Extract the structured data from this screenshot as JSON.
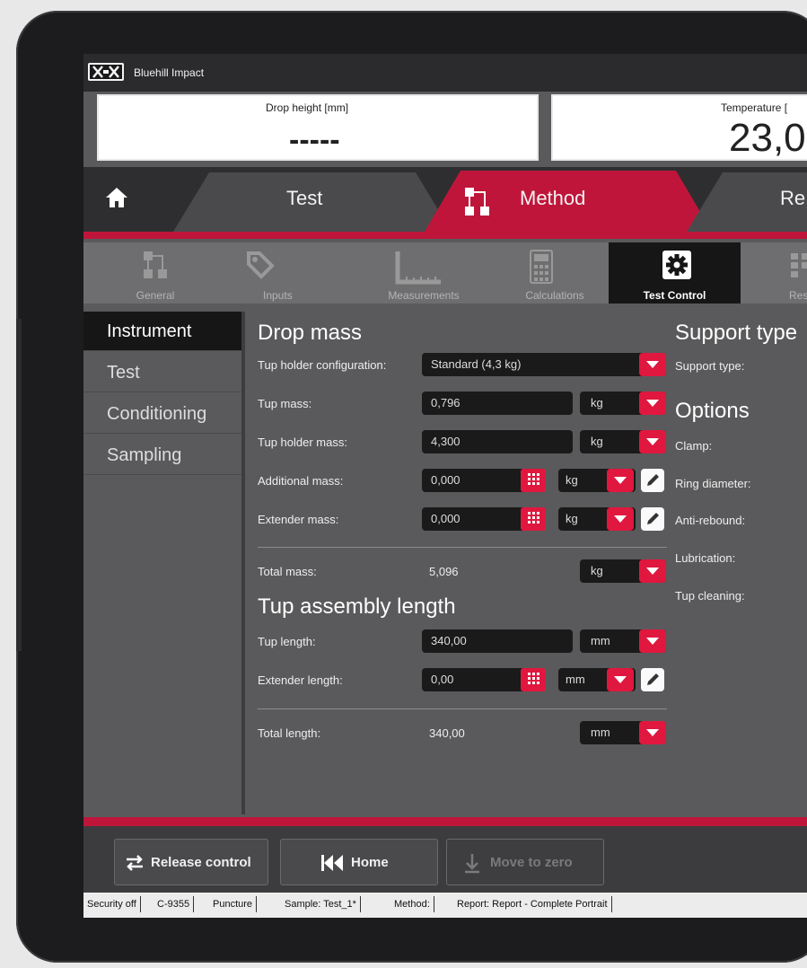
{
  "app": {
    "title": "Bluehill Impact"
  },
  "readouts": [
    {
      "label": "Drop height   [mm]",
      "value": "-----"
    },
    {
      "label": "Temperature   [",
      "value": "23,0"
    }
  ],
  "main_tabs": {
    "home_icon": "home-icon",
    "test": "Test",
    "method": "Method",
    "reports": "Re"
  },
  "sub_tabs": [
    {
      "label": "General",
      "icon": "general-icon"
    },
    {
      "label": "Inputs",
      "icon": "tag-icon"
    },
    {
      "label": "Measurements",
      "icon": "ruler-icon"
    },
    {
      "label": "Calculations",
      "icon": "calculator-icon"
    },
    {
      "label": "Test Control",
      "icon": "gear-icon"
    },
    {
      "label": "Res",
      "icon": "results-icon"
    }
  ],
  "left_nav": [
    {
      "label": "Instrument",
      "active": true
    },
    {
      "label": "Test",
      "active": false
    },
    {
      "label": "Conditioning",
      "active": false
    },
    {
      "label": "Sampling",
      "active": false
    }
  ],
  "drop_mass": {
    "title": "Drop mass",
    "tup_holder_config": {
      "label": "Tup holder configuration:",
      "value": "Standard (4,3 kg)"
    },
    "tup_mass": {
      "label": "Tup mass:",
      "value": "0,796",
      "unit": "kg"
    },
    "tup_holder_mass": {
      "label": "Tup holder mass:",
      "value": "4,300",
      "unit": "kg"
    },
    "additional_mass": {
      "label": "Additional mass:",
      "value": "0,000",
      "unit": "kg"
    },
    "extender_mass": {
      "label": "Extender mass:",
      "value": "0,000",
      "unit": "kg"
    },
    "total_mass": {
      "label": "Total mass:",
      "value": "5,096",
      "unit": "kg"
    }
  },
  "tup_assembly": {
    "title": "Tup assembly length",
    "tup_length": {
      "label": "Tup length:",
      "value": "340,00",
      "unit": "mm"
    },
    "extender_length": {
      "label": "Extender length:",
      "value": "0,00",
      "unit": "mm"
    },
    "total_length": {
      "label": "Total length:",
      "value": "340,00",
      "unit": "mm"
    }
  },
  "support": {
    "title": "Support type",
    "support_type_label": "Support type:",
    "options_title": "Options",
    "clamp": "Clamp:",
    "ring_diameter": "Ring diameter:",
    "anti_rebound": "Anti-rebound:",
    "lubrication": "Lubrication:",
    "tup_cleaning": "Tup cleaning:"
  },
  "actions": {
    "release_control": "Release control",
    "home": "Home",
    "move_to_zero": "Move to zero"
  },
  "status": [
    "Security off",
    "C-9355",
    "Puncture",
    "Sample: Test_1*",
    "Method:",
    "Report: Report - Complete Portrait"
  ],
  "colors": {
    "accent": "#e0173e",
    "panel": "#5a5a5c",
    "active": "#161616"
  }
}
